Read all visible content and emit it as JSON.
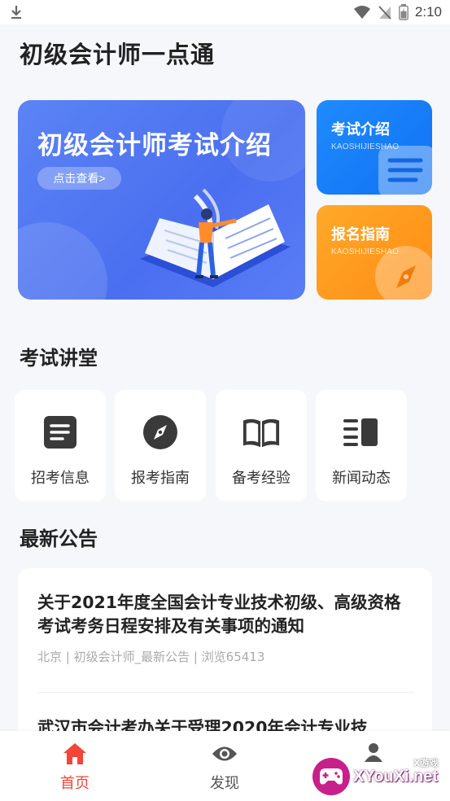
{
  "status_bar": {
    "time": "2:10"
  },
  "app_title": "初级会计师一点通",
  "banner": {
    "title": "初级会计师考试介绍",
    "button": "点击查看>"
  },
  "side_cards": [
    {
      "title": "考试介绍",
      "subtitle": "KAOSHIJIESHAO"
    },
    {
      "title": "报名指南",
      "subtitle": "KAOSHIJIESHAO"
    }
  ],
  "lecture_section": {
    "title": "考试讲堂",
    "items": [
      {
        "label": "招考信息",
        "icon": "document-icon"
      },
      {
        "label": "报考指南",
        "icon": "compass-icon"
      },
      {
        "label": "备考经验",
        "icon": "open-book-icon"
      },
      {
        "label": "新闻动态",
        "icon": "news-icon"
      }
    ]
  },
  "notices": {
    "title": "最新公告",
    "items": [
      {
        "title": "关于2021年度全国会计专业技术初级、高级资格考试考务日程安排及有关事项的通知",
        "meta": "北京 | 初级会计师_最新公告 | 浏览65413"
      },
      {
        "title": "武汉市会计考办关于受理2020年会计专业技"
      }
    ]
  },
  "tabs": [
    {
      "label": "首页",
      "icon": "home-icon",
      "active": true
    },
    {
      "label": "发现",
      "icon": "eye-icon",
      "active": false
    }
  ],
  "watermark": {
    "text": "XYouXi.net",
    "small": "X游戏"
  },
  "colors": {
    "primary": "#5b84f5",
    "blue_card": "#1e8bff",
    "orange_card": "#ff9a1e",
    "active_tab": "#f5443a",
    "inactive_tab": "#555555"
  }
}
